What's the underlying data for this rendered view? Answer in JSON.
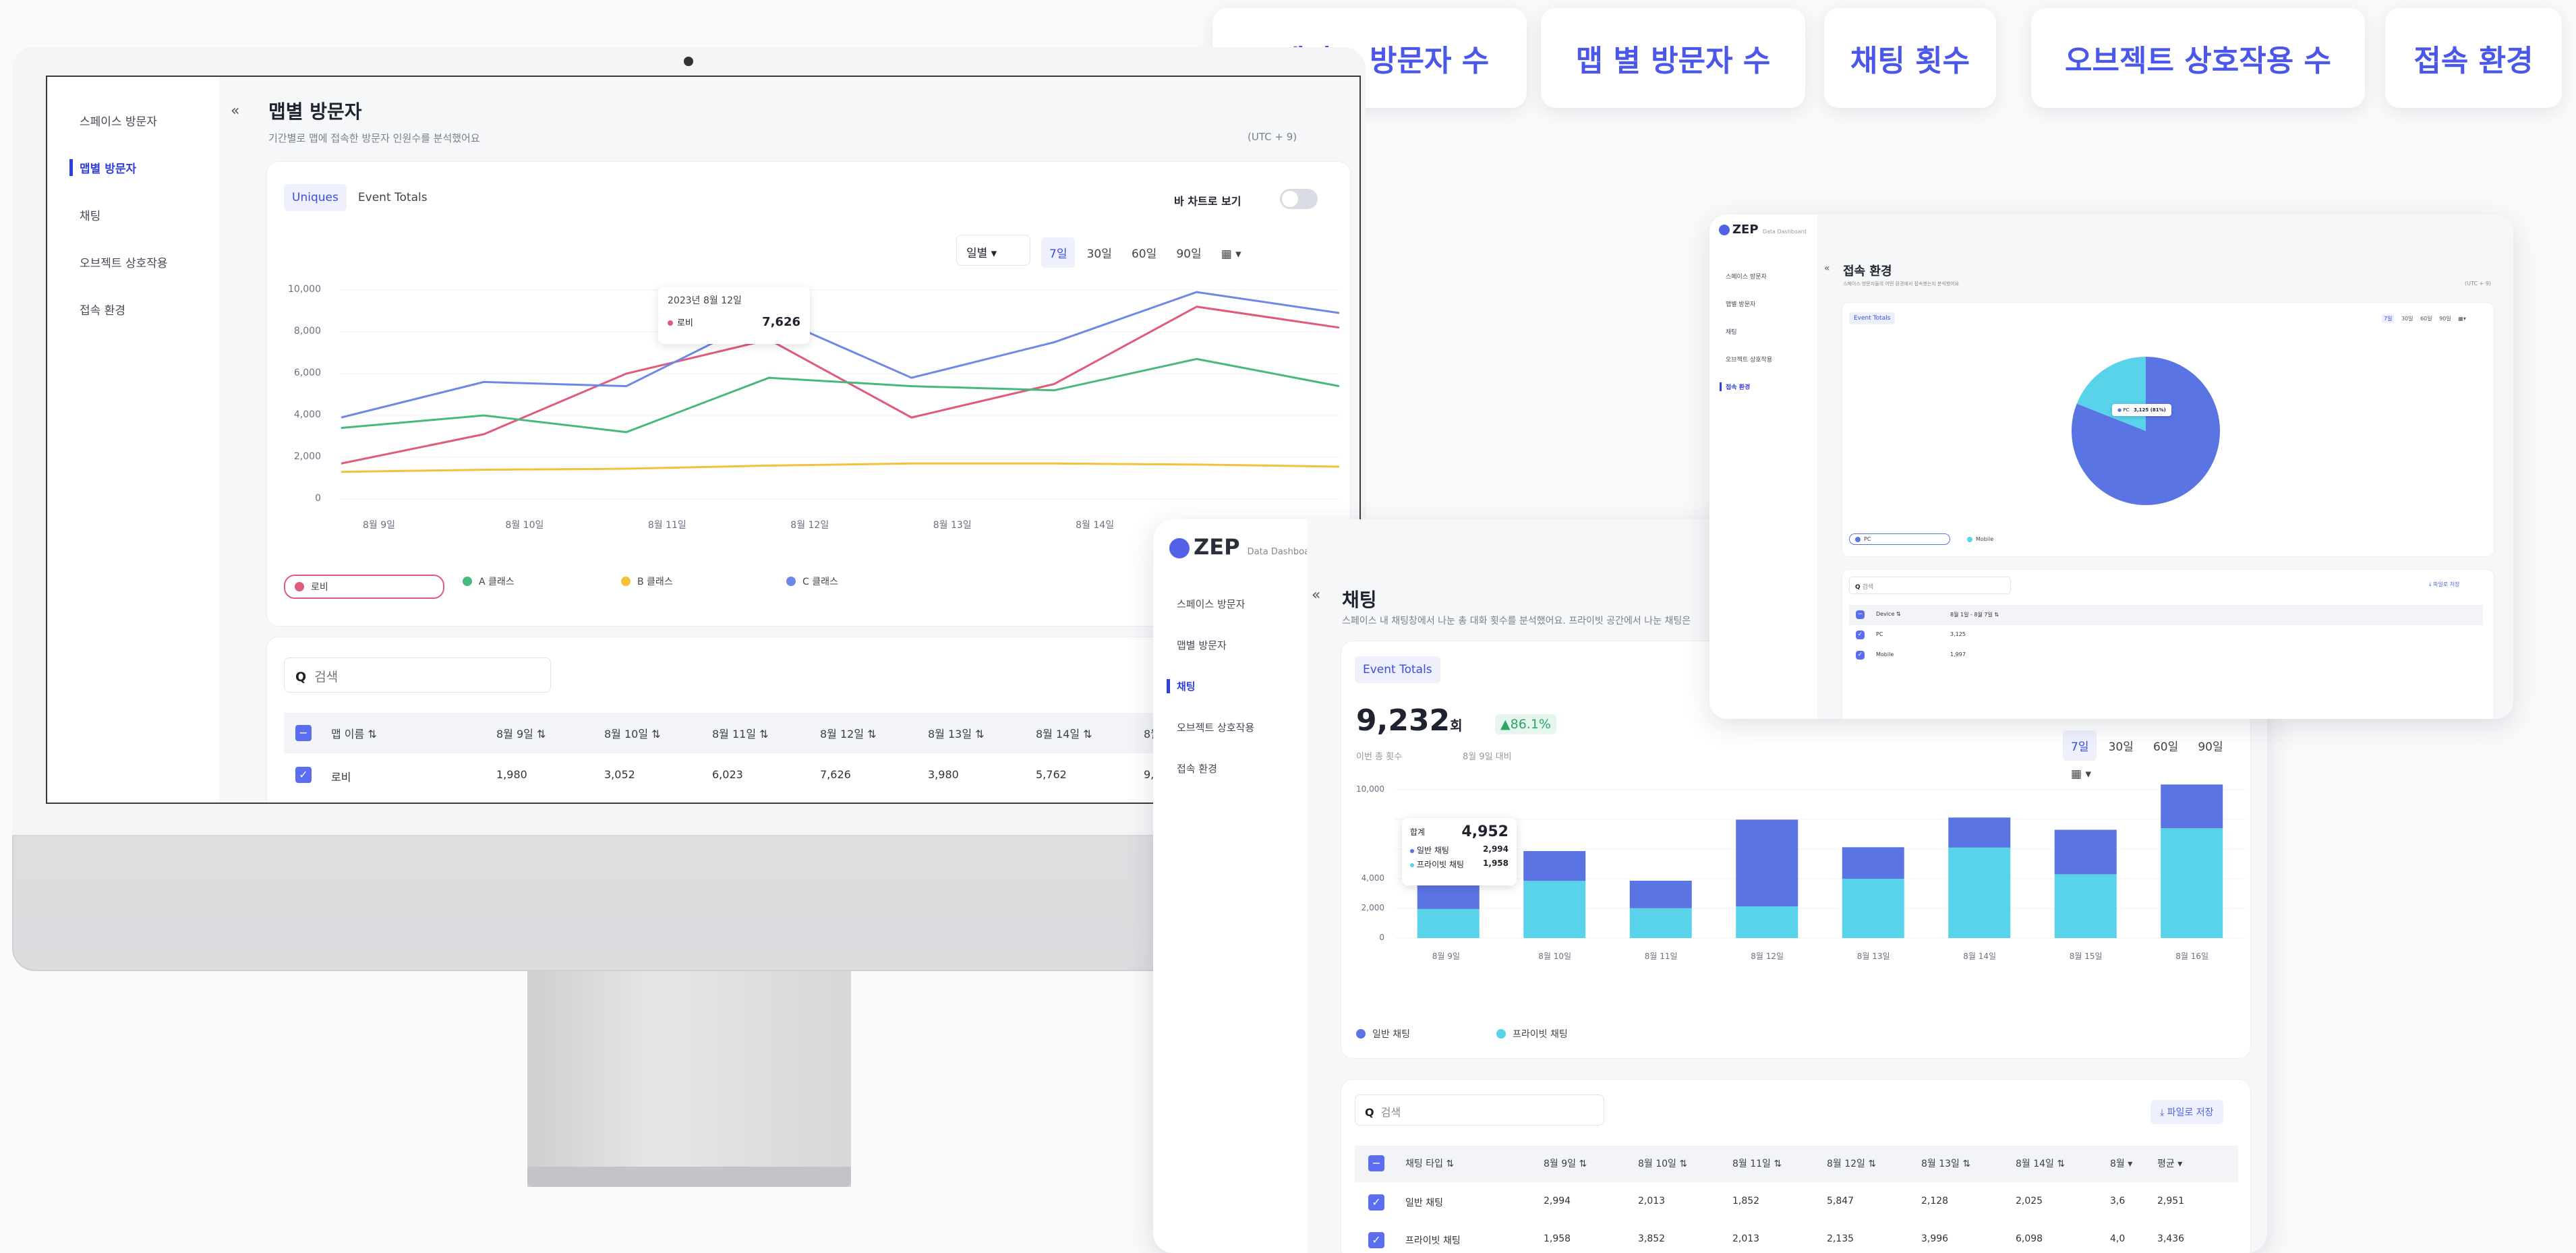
{
  "pills": [
    "스페이스 방문자 수",
    "맵 별 방문자 수",
    "채팅 횟수",
    "오브젝트 상호작용 수",
    "접속 환경"
  ],
  "sidebar": [
    "스페이스 방문자",
    "맵별 방문자",
    "채팅",
    "오브젝트 상호작용",
    "접속 환경"
  ],
  "main": {
    "title": "맵별 방문자",
    "subtitle": "기간별로 맵에 접속한 방문자 인원수를 분석했어요",
    "tz": "(UTC + 9)",
    "tab1": "Uniques",
    "tab2": "Event Totals",
    "toggle_label": "바 차트로 보기",
    "period_select": "일별",
    "ranges": [
      "7일",
      "30일",
      "60일",
      "90일"
    ],
    "tooltip_date": "2023년 8월 12일",
    "tooltip_series": "로비",
    "tooltip_value": "7,626",
    "search": "검색",
    "table_headers": [
      "맵 이름",
      "8월 9일",
      "8월 10일",
      "8월 11일",
      "8월 12일",
      "8월 13일",
      "8월 14일",
      "8월"
    ],
    "table_row": [
      "로비",
      "1,980",
      "3,052",
      "6,023",
      "7,626",
      "3,980",
      "5,762",
      "9,"
    ]
  },
  "chart_data": {
    "type": "line",
    "categories": [
      "8월 9일",
      "8월 10일",
      "8월 11일",
      "8월 12일",
      "8월 13일",
      "8월 14일",
      "8월 15일"
    ],
    "yticks": [
      "10,000",
      "8,000",
      "6,000",
      "4,000",
      "2,000",
      "0"
    ],
    "ylim": [
      0,
      10000
    ],
    "series": [
      {
        "name": "로비",
        "color": "#e05a7a",
        "values": [
          1700,
          3100,
          6000,
          7626,
          3900,
          5500,
          9200,
          8200
        ]
      },
      {
        "name": "A 클래스",
        "color": "#49b87c",
        "values": [
          3400,
          4000,
          3200,
          5800,
          5400,
          5200,
          6700,
          5400
        ]
      },
      {
        "name": "B 클래스",
        "color": "#f3c23a",
        "values": [
          1300,
          1400,
          1450,
          1600,
          1700,
          1700,
          1650,
          1550
        ]
      },
      {
        "name": "C 클래스",
        "color": "#6f88e6",
        "values": [
          3900,
          5600,
          5400,
          8800,
          5800,
          7500,
          9900,
          8900
        ]
      }
    ]
  },
  "chat": {
    "logo": "ZEP",
    "logo_sub": "Data Dashboard",
    "title": "채팅",
    "subtitle": "스페이스 내 채팅창에서 나눈 총 대화 횟수를 분석했어요. 프라이빗 공간에서 나눈 채팅은",
    "tab": "Event Totals",
    "total": "9,232",
    "unit": "회",
    "delta": "▲86.1%",
    "total_label": "이번 총 횟수",
    "delta_label": "8월 9일 대비",
    "ranges": [
      "7일",
      "30일",
      "60일",
      "90일"
    ],
    "tooltip": {
      "label": "합계",
      "value": "4,952",
      "r1": "일반 채팅",
      "v1": "2,994",
      "r2": "프라이빗 채팅",
      "v2": "1,958"
    },
    "yticks": [
      "10,000",
      "",
      "",
      "4,000",
      "2,000",
      "0"
    ],
    "xcats": [
      "8월 9일",
      "8월 10일",
      "8월 11일",
      "8월 12일",
      "8월 13일",
      "8월 14일",
      "8월 15일",
      "8월 16일"
    ],
    "legend": [
      "일반 채팅",
      "프라이빗 채팅"
    ],
    "bars": [
      [
        2994,
        1958
      ],
      [
        2013,
        3852
      ],
      [
        1852,
        2013
      ],
      [
        5847,
        2135
      ],
      [
        2128,
        3996
      ],
      [
        2025,
        6098
      ],
      [
        3000,
        4300
      ],
      [
        2951,
        7400
      ]
    ],
    "search": "검색",
    "download": "파일로 저장",
    "headers": [
      "채팅 타입",
      "8월 9일",
      "8월 10일",
      "8월 11일",
      "8월 12일",
      "8월 13일",
      "8월 14일",
      "8월",
      "평균"
    ],
    "rows": [
      [
        "일반 채팅",
        "2,994",
        "2,013",
        "1,852",
        "5,847",
        "2,128",
        "2,025",
        "3,6",
        "2,951"
      ],
      [
        "프라이빗 채팅",
        "1,958",
        "3,852",
        "2,013",
        "2,135",
        "3,996",
        "6,098",
        "4,0",
        "3,436"
      ]
    ]
  },
  "env": {
    "logo": "ZEP",
    "logo_sub": "Data Dashboard",
    "title": "접속 환경",
    "subtitle": "스페이스 방문자들의 어떤 환경에서 접속했는지 분석했어요",
    "tz": "(UTC + 9)",
    "tab": "Event Totals",
    "ranges": [
      "7일",
      "30일",
      "60일",
      "90일"
    ],
    "pie": [
      {
        "name": "PC",
        "value": 81
      },
      {
        "name": "Mobile",
        "value": 19
      }
    ],
    "pie_tip": "3,125 (81%)",
    "legend": [
      "PC",
      "Mobile"
    ],
    "search": "검색",
    "download": "파일로 저장",
    "date_header": "8월 1일 - 8월 7일",
    "rows": [
      [
        "Device",
        "8월 1일 - 8월 7일"
      ],
      [
        "PC",
        "3,125"
      ],
      [
        "Mobile",
        "1,997"
      ]
    ]
  }
}
